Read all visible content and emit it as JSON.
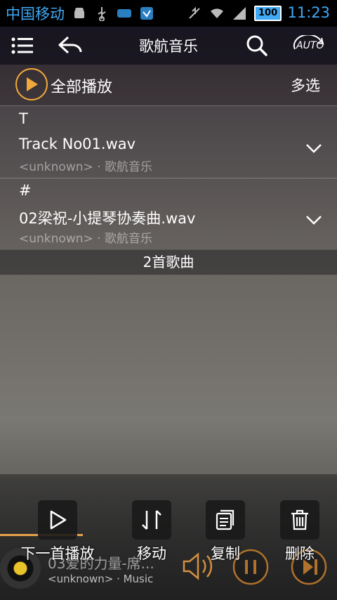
{
  "status_bar": {
    "carrier": "中国移动",
    "battery": "100",
    "time": "11:23",
    "icons": [
      "android-icon",
      "usb-icon",
      "app-notify-icon",
      "app-notify-icon-2",
      "mute-icon",
      "wifi-icon",
      "signal-icon",
      "battery-icon"
    ]
  },
  "header": {
    "title": "歌航音乐",
    "menu_icon": "menu-icon",
    "back_icon": "back-icon",
    "search_icon": "search-icon",
    "auto_label": "AUTO"
  },
  "play_all": {
    "label": "全部播放",
    "multi_select": "多选",
    "accent": "#f2a93b"
  },
  "tracks": [
    {
      "letter": "T",
      "name": "Track No01.wav",
      "meta": "<unknown> · 歌航音乐"
    },
    {
      "letter": "#",
      "name": "02梁祝-小提琴协奏曲.wav",
      "meta": "<unknown> · 歌航音乐"
    }
  ],
  "song_count": "2首歌曲",
  "now_playing": {
    "title": "03爱的力量-席...",
    "meta": "<unknown>  · Music",
    "progress": 0.25
  },
  "actions": [
    {
      "label": "下一首播放",
      "icon": "play-next-icon"
    },
    {
      "label": "移动",
      "icon": "move-icon"
    },
    {
      "label": "复制",
      "icon": "copy-icon"
    },
    {
      "label": "删除",
      "icon": "delete-icon"
    }
  ]
}
